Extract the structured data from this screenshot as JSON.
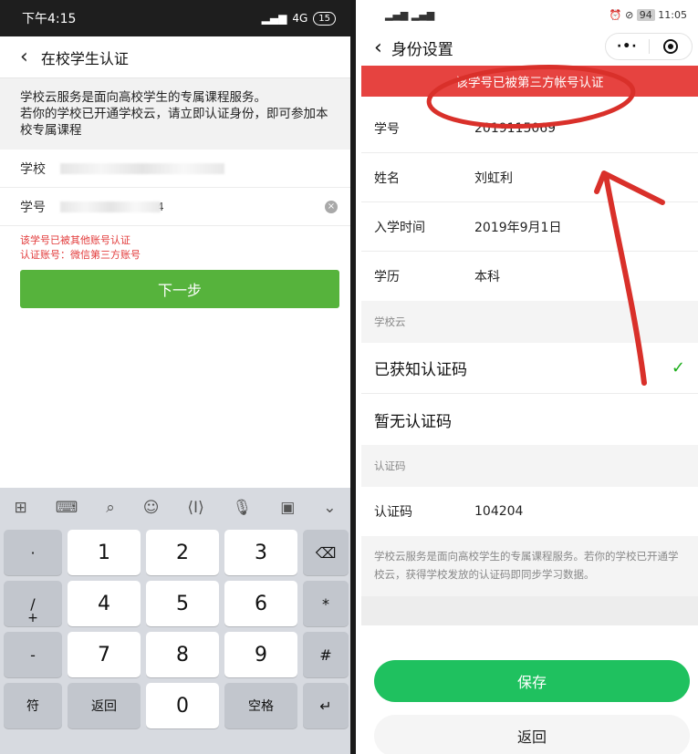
{
  "left": {
    "status": {
      "time": "下午4:15",
      "signal": "4G",
      "battery": "15"
    },
    "nav": {
      "back_icon": "chevron-left-icon",
      "title": "在校学生认证"
    },
    "intro": {
      "line1": "学校云服务是面向高校学生的专属课程服务。",
      "line2": "若你的学校已开通学校云，请立即认证身份，即可参加本校专属课程"
    },
    "form": {
      "school_label": "学校",
      "id_label": "学号",
      "id_value_tail": "4"
    },
    "error": {
      "line1": "该学号已被其他账号认证",
      "line2": "认证账号：微信第三方账号"
    },
    "next_label": "下一步",
    "keyboard": {
      "keys": {
        "dot": "·",
        "slash": "/",
        "plus": "+",
        "minus": "-",
        "k1": "1",
        "k2": "2",
        "k3": "3",
        "k4": "4",
        "k5": "5",
        "k6": "6",
        "k7": "7",
        "k8": "8",
        "k9": "9",
        "k0": "0",
        "star": "*",
        "hash": "#",
        "sym": "符",
        "back": "返回",
        "space": "空格"
      }
    }
  },
  "right": {
    "status": {
      "time": "11:05",
      "battery": "94"
    },
    "nav": {
      "title": "身份设置"
    },
    "banner": "该学号已被第三方帐号认证",
    "info": [
      {
        "label": "学号",
        "value": "2019115069"
      },
      {
        "label": "姓名",
        "value": "刘虹利"
      },
      {
        "label": "入学时间",
        "value": "2019年9月1日"
      },
      {
        "label": "学历",
        "value": "本科"
      }
    ],
    "group_school_cloud": "学校云",
    "options": [
      {
        "label": "已获知认证码",
        "checked": true
      },
      {
        "label": "暂无认证码",
        "checked": false
      }
    ],
    "group_code": "认证码",
    "code": {
      "label": "认证码",
      "value": "104204"
    },
    "footer": "学校云服务是面向高校学生的专属课程服务。若你的学校已开通学校云，获得学校发放的认证码即同步学习数据。",
    "save_label": "保存",
    "return_label": "返回",
    "accent": "#1fc15f",
    "banner_color": "#e64340"
  }
}
